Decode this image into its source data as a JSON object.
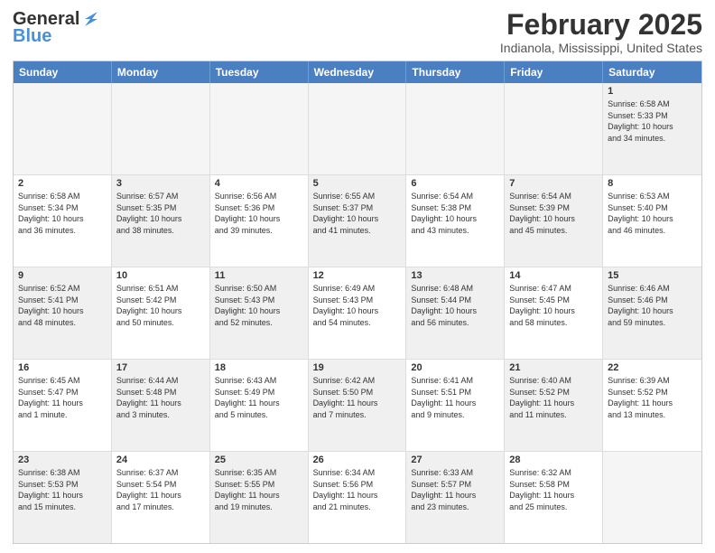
{
  "header": {
    "logo_line1": "General",
    "logo_line2": "Blue",
    "title": "February 2025",
    "subtitle": "Indianola, Mississippi, United States"
  },
  "days_of_week": [
    "Sunday",
    "Monday",
    "Tuesday",
    "Wednesday",
    "Thursday",
    "Friday",
    "Saturday"
  ],
  "weeks": [
    [
      {
        "day": "",
        "info": "",
        "empty": true
      },
      {
        "day": "",
        "info": "",
        "empty": true
      },
      {
        "day": "",
        "info": "",
        "empty": true
      },
      {
        "day": "",
        "info": "",
        "empty": true
      },
      {
        "day": "",
        "info": "",
        "empty": true
      },
      {
        "day": "",
        "info": "",
        "empty": true
      },
      {
        "day": "1",
        "info": "Sunrise: 6:58 AM\nSunset: 5:33 PM\nDaylight: 10 hours\nand 34 minutes.",
        "shaded": true
      }
    ],
    [
      {
        "day": "2",
        "info": "Sunrise: 6:58 AM\nSunset: 5:34 PM\nDaylight: 10 hours\nand 36 minutes.",
        "shaded": false
      },
      {
        "day": "3",
        "info": "Sunrise: 6:57 AM\nSunset: 5:35 PM\nDaylight: 10 hours\nand 38 minutes.",
        "shaded": true
      },
      {
        "day": "4",
        "info": "Sunrise: 6:56 AM\nSunset: 5:36 PM\nDaylight: 10 hours\nand 39 minutes.",
        "shaded": false
      },
      {
        "day": "5",
        "info": "Sunrise: 6:55 AM\nSunset: 5:37 PM\nDaylight: 10 hours\nand 41 minutes.",
        "shaded": true
      },
      {
        "day": "6",
        "info": "Sunrise: 6:54 AM\nSunset: 5:38 PM\nDaylight: 10 hours\nand 43 minutes.",
        "shaded": false
      },
      {
        "day": "7",
        "info": "Sunrise: 6:54 AM\nSunset: 5:39 PM\nDaylight: 10 hours\nand 45 minutes.",
        "shaded": true
      },
      {
        "day": "8",
        "info": "Sunrise: 6:53 AM\nSunset: 5:40 PM\nDaylight: 10 hours\nand 46 minutes.",
        "shaded": false
      }
    ],
    [
      {
        "day": "9",
        "info": "Sunrise: 6:52 AM\nSunset: 5:41 PM\nDaylight: 10 hours\nand 48 minutes.",
        "shaded": true
      },
      {
        "day": "10",
        "info": "Sunrise: 6:51 AM\nSunset: 5:42 PM\nDaylight: 10 hours\nand 50 minutes.",
        "shaded": false
      },
      {
        "day": "11",
        "info": "Sunrise: 6:50 AM\nSunset: 5:43 PM\nDaylight: 10 hours\nand 52 minutes.",
        "shaded": true
      },
      {
        "day": "12",
        "info": "Sunrise: 6:49 AM\nSunset: 5:43 PM\nDaylight: 10 hours\nand 54 minutes.",
        "shaded": false
      },
      {
        "day": "13",
        "info": "Sunrise: 6:48 AM\nSunset: 5:44 PM\nDaylight: 10 hours\nand 56 minutes.",
        "shaded": true
      },
      {
        "day": "14",
        "info": "Sunrise: 6:47 AM\nSunset: 5:45 PM\nDaylight: 10 hours\nand 58 minutes.",
        "shaded": false
      },
      {
        "day": "15",
        "info": "Sunrise: 6:46 AM\nSunset: 5:46 PM\nDaylight: 10 hours\nand 59 minutes.",
        "shaded": true
      }
    ],
    [
      {
        "day": "16",
        "info": "Sunrise: 6:45 AM\nSunset: 5:47 PM\nDaylight: 11 hours\nand 1 minute.",
        "shaded": false
      },
      {
        "day": "17",
        "info": "Sunrise: 6:44 AM\nSunset: 5:48 PM\nDaylight: 11 hours\nand 3 minutes.",
        "shaded": true
      },
      {
        "day": "18",
        "info": "Sunrise: 6:43 AM\nSunset: 5:49 PM\nDaylight: 11 hours\nand 5 minutes.",
        "shaded": false
      },
      {
        "day": "19",
        "info": "Sunrise: 6:42 AM\nSunset: 5:50 PM\nDaylight: 11 hours\nand 7 minutes.",
        "shaded": true
      },
      {
        "day": "20",
        "info": "Sunrise: 6:41 AM\nSunset: 5:51 PM\nDaylight: 11 hours\nand 9 minutes.",
        "shaded": false
      },
      {
        "day": "21",
        "info": "Sunrise: 6:40 AM\nSunset: 5:52 PM\nDaylight: 11 hours\nand 11 minutes.",
        "shaded": true
      },
      {
        "day": "22",
        "info": "Sunrise: 6:39 AM\nSunset: 5:52 PM\nDaylight: 11 hours\nand 13 minutes.",
        "shaded": false
      }
    ],
    [
      {
        "day": "23",
        "info": "Sunrise: 6:38 AM\nSunset: 5:53 PM\nDaylight: 11 hours\nand 15 minutes.",
        "shaded": true
      },
      {
        "day": "24",
        "info": "Sunrise: 6:37 AM\nSunset: 5:54 PM\nDaylight: 11 hours\nand 17 minutes.",
        "shaded": false
      },
      {
        "day": "25",
        "info": "Sunrise: 6:35 AM\nSunset: 5:55 PM\nDaylight: 11 hours\nand 19 minutes.",
        "shaded": true
      },
      {
        "day": "26",
        "info": "Sunrise: 6:34 AM\nSunset: 5:56 PM\nDaylight: 11 hours\nand 21 minutes.",
        "shaded": false
      },
      {
        "day": "27",
        "info": "Sunrise: 6:33 AM\nSunset: 5:57 PM\nDaylight: 11 hours\nand 23 minutes.",
        "shaded": true
      },
      {
        "day": "28",
        "info": "Sunrise: 6:32 AM\nSunset: 5:58 PM\nDaylight: 11 hours\nand 25 minutes.",
        "shaded": false
      },
      {
        "day": "",
        "info": "",
        "empty": true
      }
    ]
  ]
}
